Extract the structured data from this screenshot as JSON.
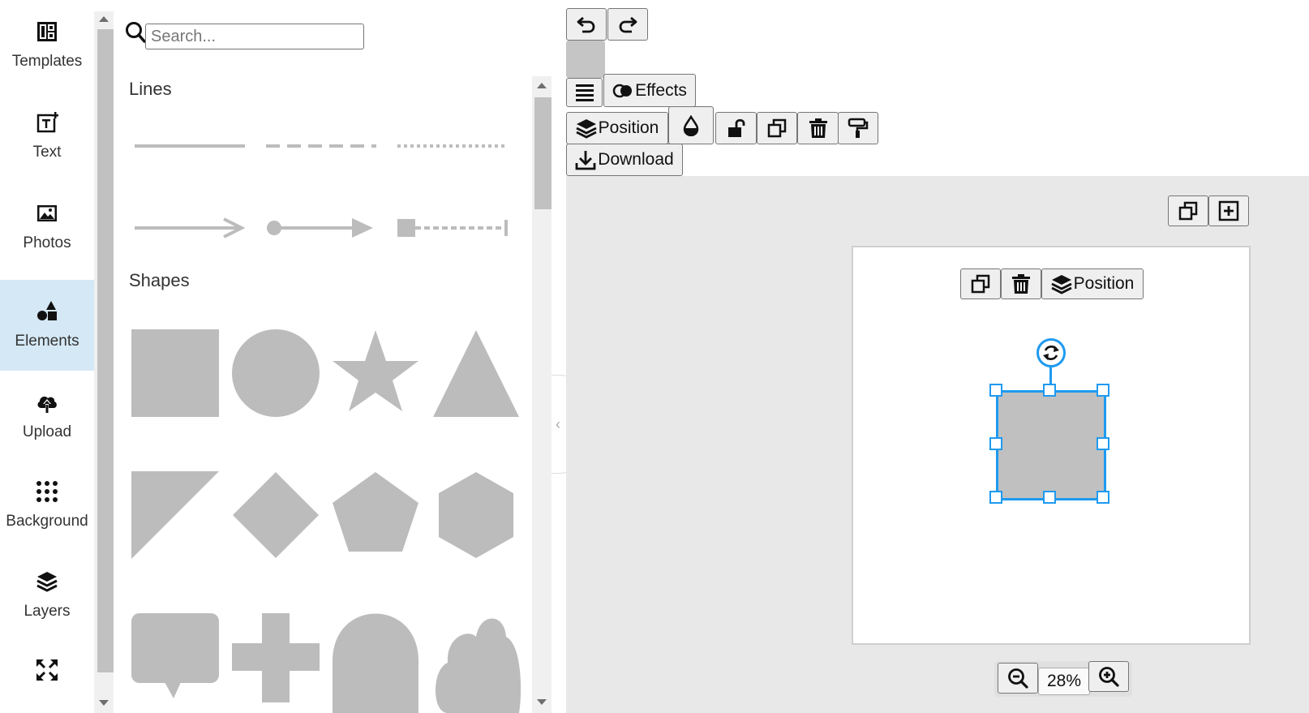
{
  "sidebar": {
    "items": [
      {
        "label": "Templates",
        "icon": "templates-icon"
      },
      {
        "label": "Text",
        "icon": "text-icon"
      },
      {
        "label": "Photos",
        "icon": "photos-icon"
      },
      {
        "label": "Elements",
        "icon": "elements-icon",
        "active": true
      },
      {
        "label": "Upload",
        "icon": "upload-icon"
      },
      {
        "label": "Background",
        "icon": "background-icon"
      },
      {
        "label": "Layers",
        "icon": "layers-icon"
      },
      {
        "label": "",
        "icon": "resize-icon"
      }
    ]
  },
  "panel": {
    "search_placeholder": "Search...",
    "sections": {
      "lines": "Lines",
      "shapes": "Shapes"
    }
  },
  "toolbar": {
    "effects_label": "Effects",
    "position_label": "Position",
    "download_label": "Download"
  },
  "canvas": {
    "inline_position_label": "Position",
    "zoom": "28%"
  },
  "colors": {
    "shape_fill": "#c0c0c0",
    "selection": "#1e9af0",
    "active_nav_bg": "#d5e8f5"
  }
}
